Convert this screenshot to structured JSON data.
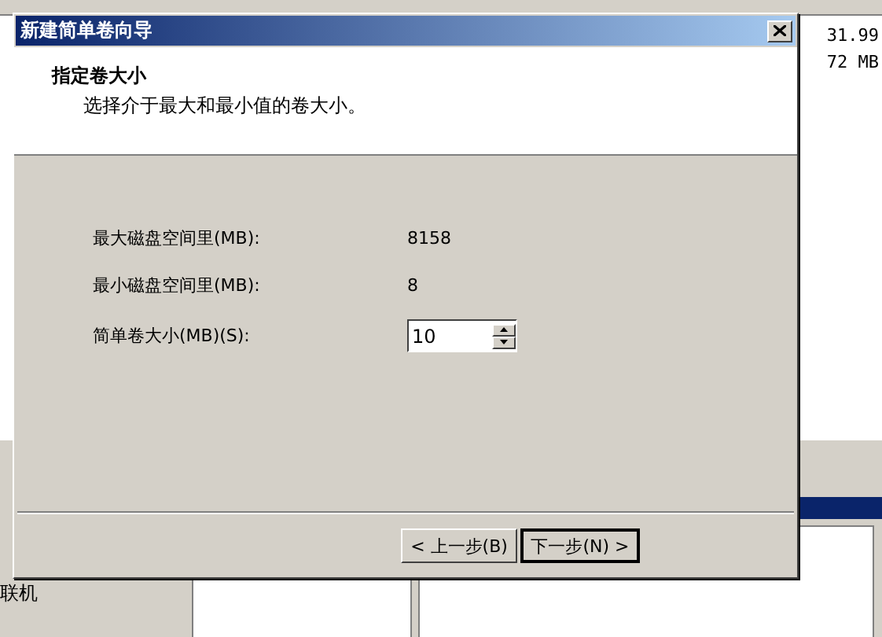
{
  "background": {
    "list_cells": [
      "31.99",
      "72 MB"
    ],
    "disk_label": "联机"
  },
  "dialog": {
    "title": "新建简单卷向导",
    "heading": "指定卷大小",
    "subheading": "选择介于最大和最小值的卷大小。",
    "fields": [
      {
        "kind": "text",
        "label": "最大磁盘空间里(MB):",
        "value": "8158"
      },
      {
        "kind": "text",
        "label": "最小磁盘空间里(MB):",
        "value": "8"
      },
      {
        "kind": "spin",
        "label": "简单卷大小(MB)(S):",
        "value": "10"
      }
    ],
    "buttons": [
      {
        "label": "< 上一步(B)",
        "default": false
      },
      {
        "label": "下一步(N) >",
        "default": true
      }
    ]
  }
}
